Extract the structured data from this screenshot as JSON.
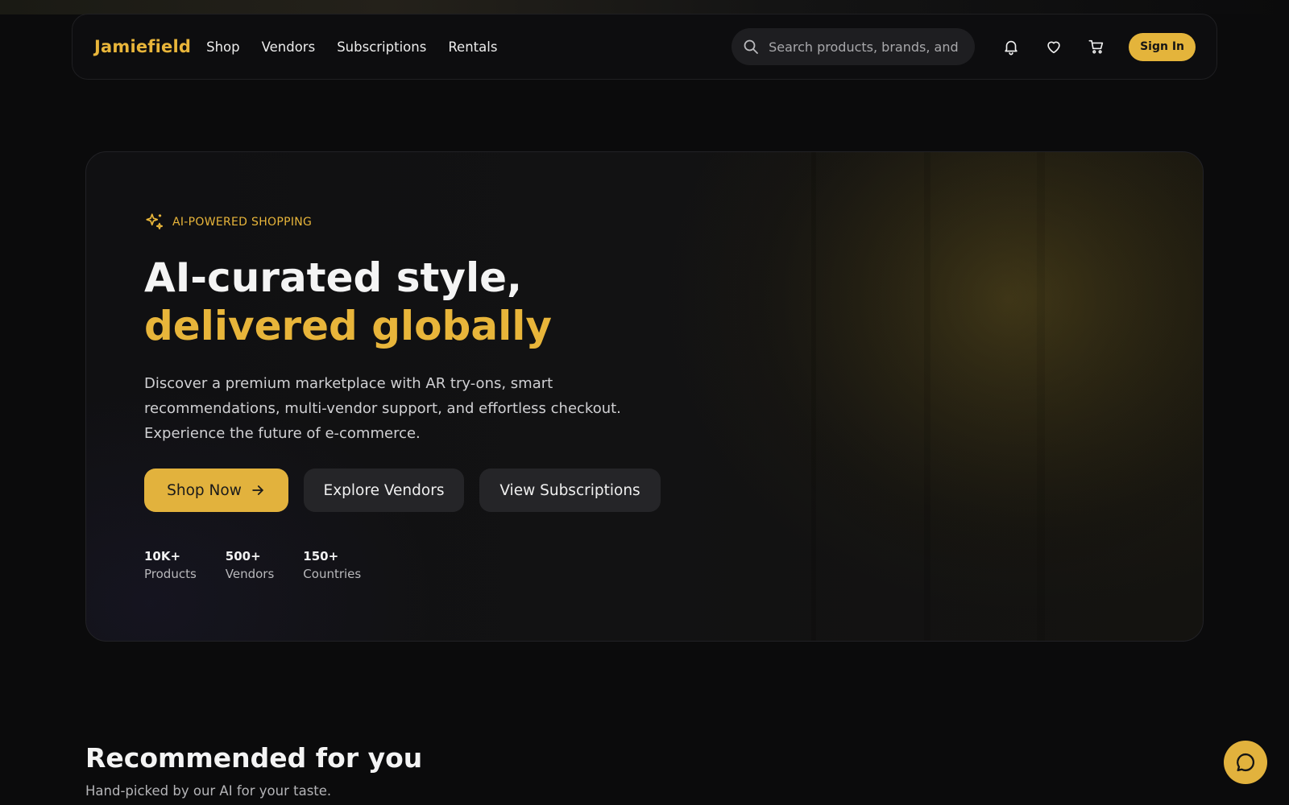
{
  "brand": "Jamiefield",
  "nav": {
    "links": [
      "Shop",
      "Vendors",
      "Subscriptions",
      "Rentals"
    ]
  },
  "search": {
    "placeholder": "Search products, brands, and looks"
  },
  "header_icons": [
    "bell-icon",
    "heart-icon",
    "cart-icon"
  ],
  "signin_label": "Sign In",
  "hero": {
    "badge": "AI-POWERED SHOPPING",
    "title_plain": "AI-curated style, ",
    "title_accent": "delivered globally",
    "description": "Discover a premium marketplace with AR try-ons, smart recommendations, multi-vendor support, and effortless checkout. Experience the future of e-commerce.",
    "buttons": {
      "primary": "Shop Now",
      "vendors": "Explore Vendors",
      "subscriptions": "View Subscriptions"
    },
    "stats": [
      {
        "value": "10K+",
        "label": "Products"
      },
      {
        "value": "500+",
        "label": "Vendors"
      },
      {
        "value": "150+",
        "label": "Countries"
      }
    ]
  },
  "recommended": {
    "title": "Recommended for you",
    "subtitle": "Hand-picked by our AI for your taste."
  },
  "colors": {
    "accent": "#e4b43b",
    "background": "#0b0b0c",
    "surface": "#252528"
  }
}
